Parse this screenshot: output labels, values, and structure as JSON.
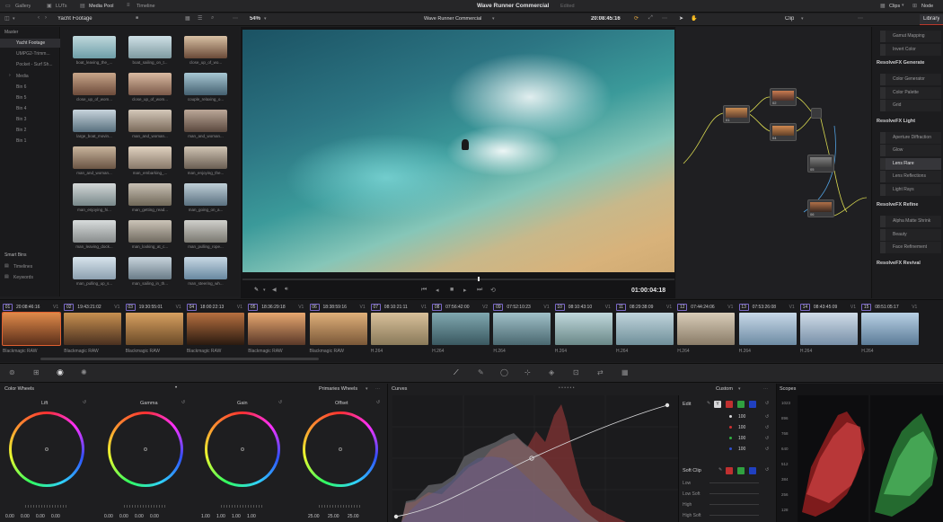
{
  "topbar": {
    "gallery": "Gallery",
    "luts": "LUTs",
    "media_pool": "Media Pool",
    "timeline": "Timeline",
    "project_title": "Wave Runner Commercial",
    "edited": "Edited",
    "clips": "Clips",
    "nodes": "Node"
  },
  "media_toolbar": {
    "bin_name": "Yacht Footage",
    "zoom": "54%",
    "timeline_name": "Wave Runner Commercial",
    "timecode": "20:08:45:16",
    "clip_mode": "Clip",
    "library_tab": "Library"
  },
  "bins": {
    "master": "Master",
    "items": [
      "Yacht Footage",
      "UMPG2-Trimm...",
      "Pocket - Surf Sh...",
      "Media",
      "Bin 6",
      "Bin 5",
      "Bin 4",
      "Bin 3",
      "Bin 2",
      "Bin 1"
    ],
    "smart_bins": "Smart Bins",
    "smart_items": [
      "Timelines",
      "Keywords"
    ]
  },
  "media_clips": [
    "boat_leaving_the_...",
    "boat_sailing_on_t...",
    "close_up_of_wo...",
    "close_up_of_wom...",
    "close_up_of_wom...",
    "couple_relaxing_o...",
    "large_boat_movin...",
    "man_and_woman...",
    "man_and_woman...",
    "man_and_woman...",
    "man_embarking_...",
    "man_enjoying_the...",
    "man_enjoying_hi...",
    "man_getting_read...",
    "man_going_on_a...",
    "man_leaving_dock...",
    "man_looking_at_c...",
    "man_pulling_rope...",
    "man_pulling_up_s...",
    "man_sailing_in_th...",
    "man_steering_wh...",
    "",
    "",
    ""
  ],
  "viewer": {
    "timecode": "01:00:04:18"
  },
  "effects_library": {
    "top_items": [
      "Gamut Mapping",
      "Invert Color"
    ],
    "sections": [
      {
        "title": "ResolveFX Generate",
        "items": [
          "Color Generator",
          "Color Palette",
          "Grid"
        ]
      },
      {
        "title": "ResolveFX Light",
        "items": [
          "Aperture Diffraction",
          "Glow",
          "Lens Flare",
          "Lens Reflections",
          "Light Rays"
        ]
      },
      {
        "title": "ResolveFX Refine",
        "items": [
          "Alpha Matte Shrink and...",
          "Beauty",
          "Face Refinement"
        ]
      },
      {
        "title": "ResolveFX Revival",
        "items": []
      }
    ]
  },
  "nodes": [
    {
      "label": "01"
    },
    {
      "label": "02"
    },
    {
      "label": "04"
    },
    {
      "label": "05"
    },
    {
      "label": "06"
    }
  ],
  "timeline_clips": [
    {
      "num": "01",
      "tc": "20:08:46:16",
      "track": "V1",
      "codec": "Blackmagic RAW"
    },
    {
      "num": "02",
      "tc": "19:43:21:02",
      "track": "V1",
      "codec": "Blackmagic RAW"
    },
    {
      "num": "03",
      "tc": "19:30:55:01",
      "track": "V1",
      "codec": "Blackmagic RAW"
    },
    {
      "num": "04",
      "tc": "18:00:22:13",
      "track": "V1",
      "codec": "Blackmagic RAW"
    },
    {
      "num": "05",
      "tc": "18:36:29:18",
      "track": "V1",
      "codec": "Blackmagic RAW"
    },
    {
      "num": "06",
      "tc": "18:38:59:16",
      "track": "V1",
      "codec": "Blackmagic RAW"
    },
    {
      "num": "07",
      "tc": "08:10:21:11",
      "track": "V1",
      "codec": "H.264"
    },
    {
      "num": "08",
      "tc": "07:56:42:00",
      "track": "V2",
      "codec": "H.264"
    },
    {
      "num": "09",
      "tc": "07:52:10:23",
      "track": "V1",
      "codec": "H.264"
    },
    {
      "num": "10",
      "tc": "08:10:43:10",
      "track": "V1",
      "codec": "H.264"
    },
    {
      "num": "11",
      "tc": "08:29:38:09",
      "track": "V1",
      "codec": "H.264"
    },
    {
      "num": "12",
      "tc": "07:44:24:06",
      "track": "V1",
      "codec": "H.264"
    },
    {
      "num": "13",
      "tc": "07:53:26:08",
      "track": "V1",
      "codec": "H.264"
    },
    {
      "num": "14",
      "tc": "08:43:45:09",
      "track": "V1",
      "codec": "H.264"
    },
    {
      "num": "15",
      "tc": "08:51:05:17",
      "track": "V1",
      "codec": "H.264"
    }
  ],
  "color_wheels": {
    "title": "Color Wheels",
    "mode": "Primaries Wheels",
    "wheels": [
      {
        "name": "Lift",
        "values": [
          "0.00",
          "0.00",
          "0.00",
          "0.00"
        ]
      },
      {
        "name": "Gamma",
        "values": [
          "0.00",
          "0.00",
          "0.00",
          "0.00"
        ]
      },
      {
        "name": "Gain",
        "values": [
          "1.00",
          "1.00",
          "1.00",
          "1.00"
        ]
      },
      {
        "name": "Offset",
        "values": [
          "25.00",
          "25.00",
          "25.00"
        ]
      }
    ]
  },
  "curves": {
    "title": "Curves",
    "mode": "Custom"
  },
  "edit_panel": {
    "title": "Edit",
    "values": [
      "100",
      "100",
      "100",
      "100"
    ],
    "soft_clip": "Soft Clip",
    "soft_items": [
      "Low",
      "Low Soft",
      "High",
      "High Soft"
    ]
  },
  "scopes": {
    "title": "Scopes",
    "ticks": [
      "1023",
      "896",
      "768",
      "640",
      "512",
      "384",
      "256",
      "128"
    ]
  }
}
